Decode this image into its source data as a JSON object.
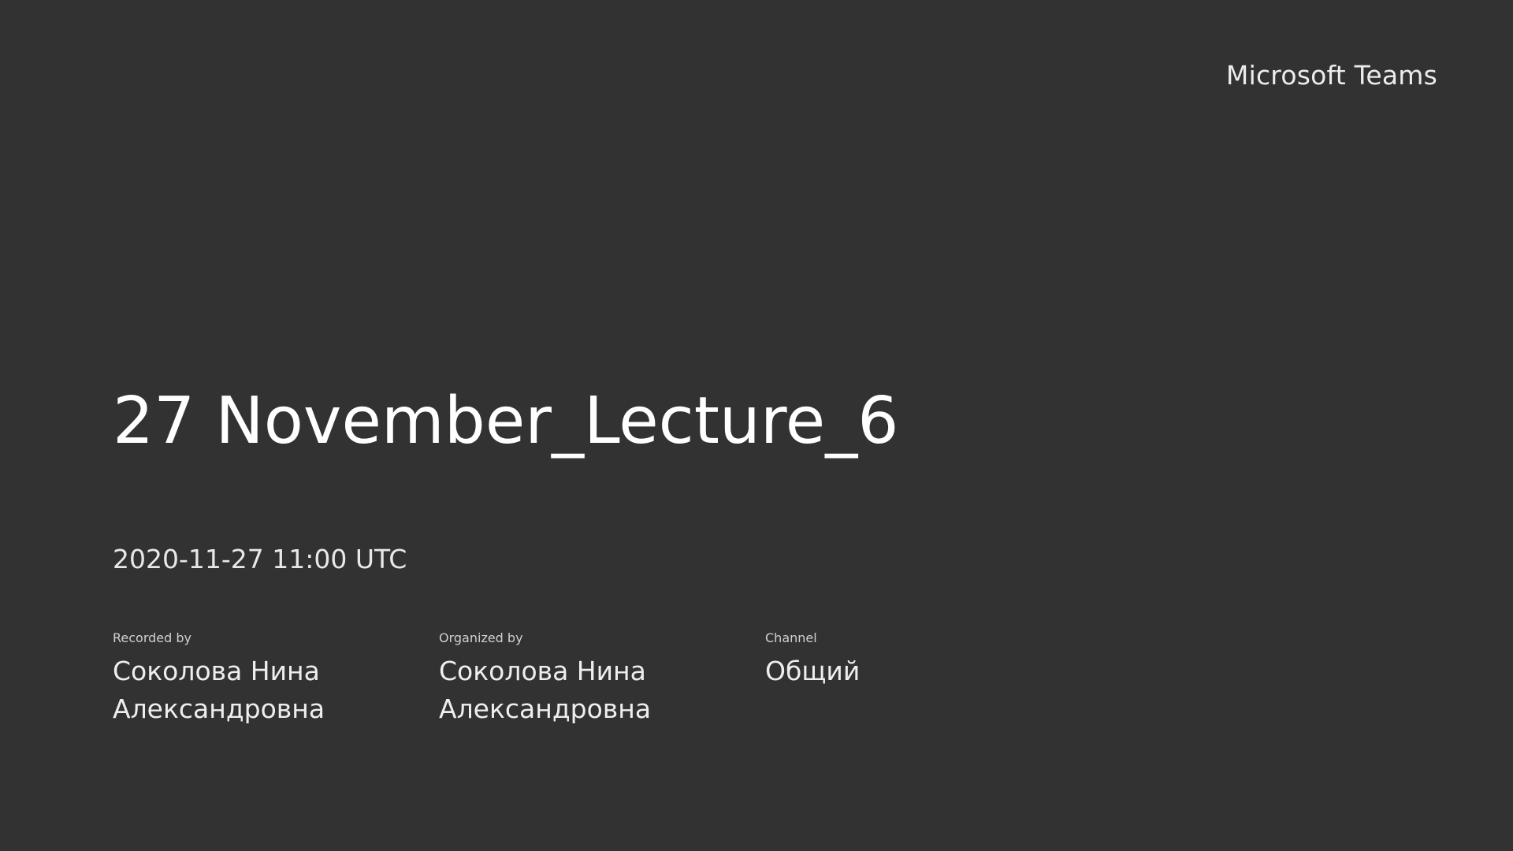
{
  "brand": {
    "name": "Microsoft Teams"
  },
  "meeting": {
    "title": "27 November_Lecture_6",
    "datetime": "2020-11-27 11:00 UTC"
  },
  "meta": {
    "recorded_by": {
      "label": "Recorded by",
      "value": "Соколова Нина Александровна"
    },
    "organized_by": {
      "label": "Organized by",
      "value": "Соколова Нина Александровна"
    },
    "channel": {
      "label": "Channel",
      "value": "Общий"
    }
  },
  "colors": {
    "background": "#323232",
    "text": "#f2f2f2"
  }
}
